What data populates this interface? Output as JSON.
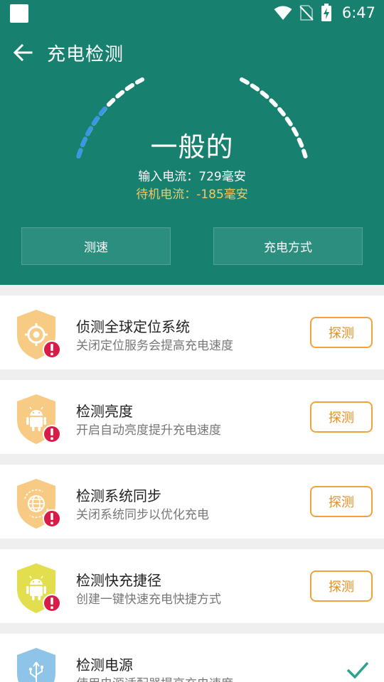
{
  "status_bar": {
    "time": "6:47"
  },
  "app_bar": {
    "title": "充电检测"
  },
  "gauge": {
    "status": "一般的",
    "input_current": "输入电流：729毫安",
    "standby_current": "待机电流：-185毫安"
  },
  "buttons": {
    "speed": "测速",
    "charge_mode": "充电方式"
  },
  "items": [
    {
      "title": "侦测全球定位系统",
      "subtitle": "关闭定位服务会提高充电速度",
      "action": "探测"
    },
    {
      "title": "检测亮度",
      "subtitle": "开启自动亮度提升充电速度",
      "action": "探测"
    },
    {
      "title": "检测系统同步",
      "subtitle": "关闭系统同步以优化充电",
      "action": "探测"
    },
    {
      "title": "检测快充捷径",
      "subtitle": "创建一键快速充电快捷方式",
      "action": "探测"
    },
    {
      "title": "检测电源",
      "subtitle": "使用电源适配器提高充电速度",
      "action": ""
    }
  ],
  "colors": {
    "header": "#17806f",
    "standby_text": "#f3c865",
    "probe_orange": "#f2a23a",
    "shield_orange": "#f7cb83",
    "shield_yellow": "#e3de4e",
    "shield_blue": "#8ec4e8",
    "alert_red": "#d81b47",
    "check_green": "#2aa38d"
  }
}
